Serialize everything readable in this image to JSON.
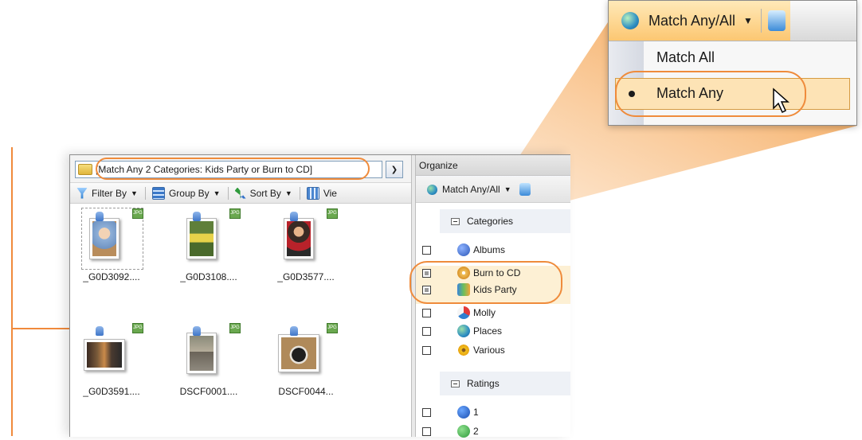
{
  "colors": {
    "accent": "#f08a3c",
    "highlight": "#fde3b5",
    "selection_bg": "#fdf0d4"
  },
  "address_bar": {
    "text": "[Match Any 2 Categories: Kids Party or Burn to CD]",
    "icon": "folder-icon"
  },
  "toolbar": {
    "filter_by": "Filter By",
    "group_by": "Group By",
    "sort_by": "Sort By",
    "view": "Vie"
  },
  "thumbnails": [
    {
      "label": "_G0D3092....",
      "selected": true
    },
    {
      "label": "_G0D3108....",
      "selected": false
    },
    {
      "label": "_G0D3577....",
      "selected": false
    },
    {
      "label": "_G0D3591....",
      "selected": false
    },
    {
      "label": "DSCF0001....",
      "selected": false
    },
    {
      "label": "DSCF0044...",
      "selected": false
    }
  ],
  "organize": {
    "title": "Organize",
    "match_button": "Match Any/All",
    "categories_header": "Categories",
    "items": [
      {
        "label": "Albums",
        "checked": false
      },
      {
        "label": "Burn to CD",
        "checked": true
      },
      {
        "label": "Kids Party",
        "checked": true
      },
      {
        "label": "Molly",
        "checked": false
      },
      {
        "label": "Places",
        "checked": false
      },
      {
        "label": "Various",
        "checked": false
      }
    ],
    "ratings_header": "Ratings",
    "ratings": [
      "1",
      "2"
    ]
  },
  "zoom": {
    "match_button": "Match Any/All",
    "menu": {
      "match_all": "Match All",
      "match_any": "Match Any"
    },
    "selected": "Match Any"
  }
}
